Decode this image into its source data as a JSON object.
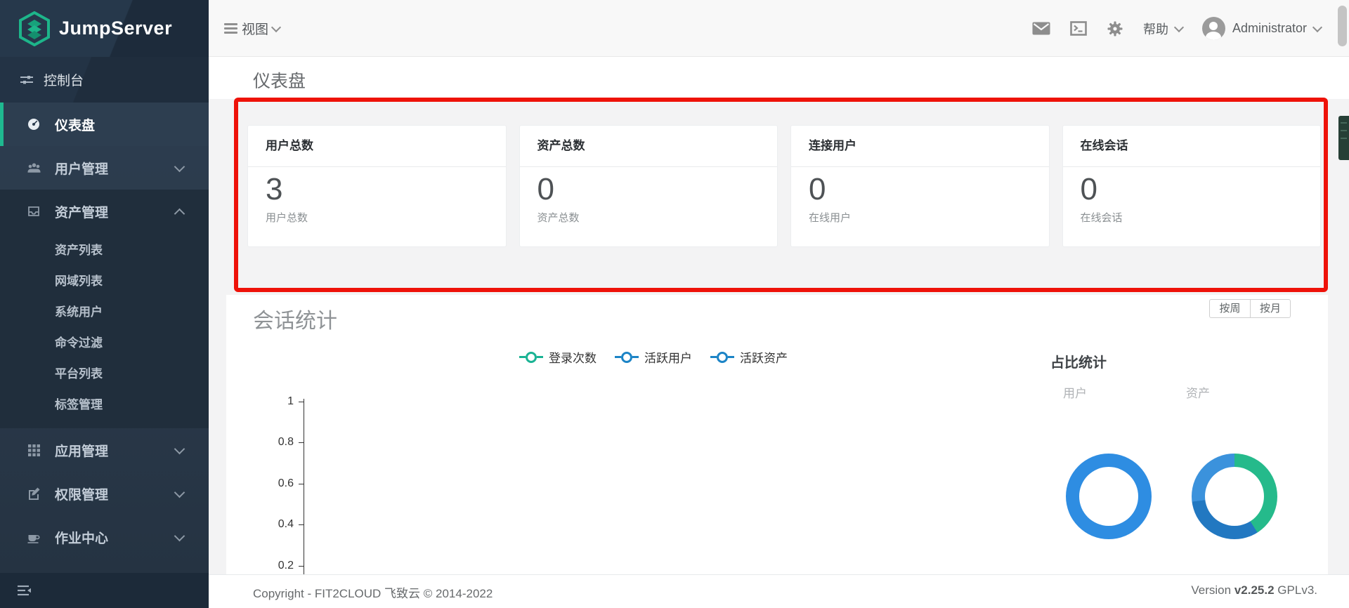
{
  "brand": {
    "name": "JumpServer"
  },
  "sidebar": {
    "console_label": "控制台",
    "items": [
      {
        "label": "仪表盘",
        "icon": "gauge-icon",
        "active": true
      },
      {
        "label": "用户管理",
        "icon": "users-icon",
        "chevron": "down"
      },
      {
        "label": "资产管理",
        "icon": "inbox-icon",
        "chevron": "up",
        "expanded": true,
        "children": [
          "资产列表",
          "网域列表",
          "系统用户",
          "命令过滤",
          "平台列表",
          "标签管理"
        ]
      },
      {
        "label": "应用管理",
        "icon": "grid-icon",
        "chevron": "down"
      },
      {
        "label": "权限管理",
        "icon": "edit-icon",
        "chevron": "down"
      },
      {
        "label": "作业中心",
        "icon": "coffee-icon",
        "chevron": "down"
      }
    ]
  },
  "topbar": {
    "view_label": "视图",
    "help_label": "帮助",
    "user_name": "Administrator",
    "icons": [
      "mail-icon",
      "web-terminal-icon",
      "gear-icon"
    ]
  },
  "page": {
    "title": "仪表盘"
  },
  "cards": [
    {
      "title": "用户总数",
      "value": "3",
      "sublabel": "用户总数"
    },
    {
      "title": "资产总数",
      "value": "0",
      "sublabel": "资产总数"
    },
    {
      "title": "连接用户",
      "value": "0",
      "sublabel": "在线用户"
    },
    {
      "title": "在线会话",
      "value": "0",
      "sublabel": "在线会话"
    }
  ],
  "session": {
    "title": "会话统计",
    "range_buttons": [
      "按周",
      "按月"
    ]
  },
  "ratio": {
    "title": "占比统计"
  },
  "footer": {
    "copyright": "Copyright - FIT2CLOUD 飞致云 © 2014-2022",
    "version_prefix": "Version",
    "version": "v2.25.2",
    "license": "GPLv3."
  },
  "colors": {
    "sidebar_accent_green": "#1fb990",
    "annotation_red": "#ee1209",
    "series_teal": "#1ab394",
    "series_blue": "#1c84c6"
  },
  "chart_data": [
    {
      "type": "line",
      "title": "会话统计",
      "legend_position": "top-center",
      "series": [
        {
          "name": "登录次数",
          "color": "#1ab394",
          "values": []
        },
        {
          "name": "活跃用户",
          "color": "#1c84c6",
          "values": []
        },
        {
          "name": "活跃资产",
          "color": "#1c84c6",
          "values": []
        }
      ],
      "yticks": [
        "1",
        "0.8",
        "0.6",
        "0.4",
        "0.2"
      ],
      "ylim": [
        0,
        1
      ],
      "grid": false,
      "x_axis_visible": false
    },
    {
      "type": "pie",
      "label": "用户",
      "slices": [
        {
          "name": "用户",
          "value": 100,
          "color": "#2e8de2"
        }
      ]
    },
    {
      "type": "pie",
      "label": "资产",
      "slices": [
        {
          "value": 41,
          "color": "#25ba8b"
        },
        {
          "value": 32,
          "color": "#2278c1"
        },
        {
          "value": 27,
          "color": "#3b92dc"
        }
      ]
    }
  ]
}
